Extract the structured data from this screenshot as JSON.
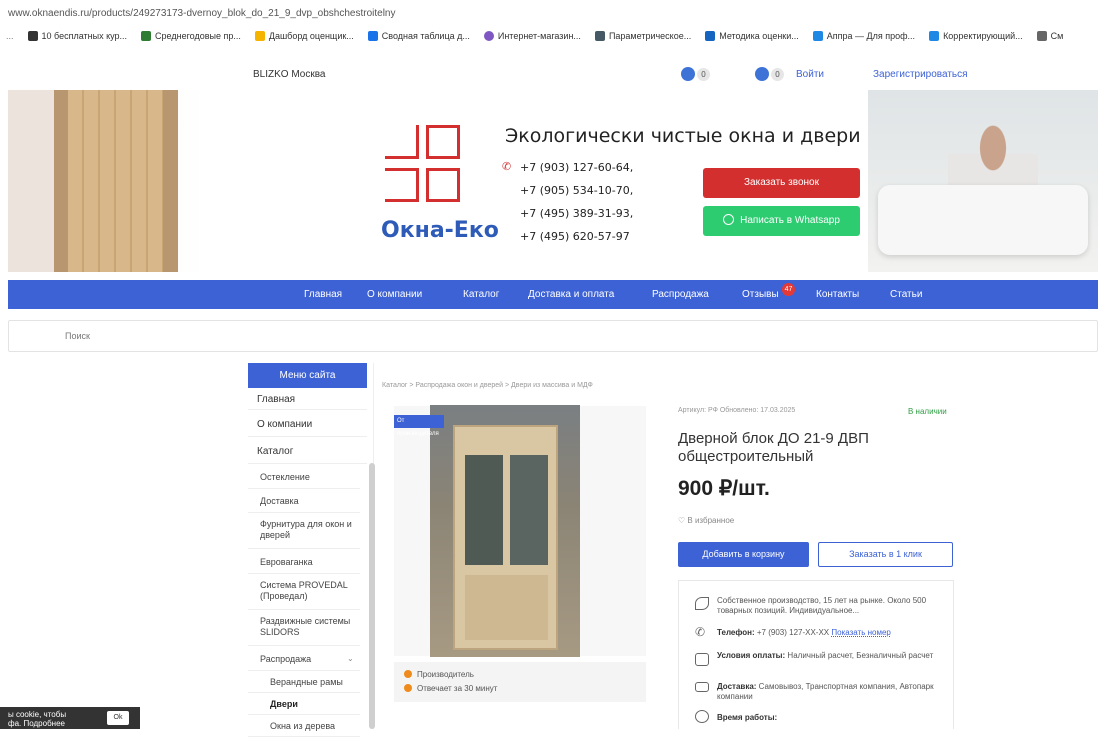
{
  "browser": {
    "url": "www.oknaendis.ru/products/249273173-dvernoy_blok_do_21_9_dvp_obshchestroitelny",
    "bookmarks": [
      {
        "label": "10 бесплатных кур...",
        "color": "#333"
      },
      {
        "label": "Среднегодовые пр...",
        "color": "#2e7d32"
      },
      {
        "label": "Дашборд оценщик...",
        "color": "#f4b400"
      },
      {
        "label": "Сводная таблица д...",
        "color": "#1a73e8"
      },
      {
        "label": "Интернет-магазин...",
        "color": "#7e57c2"
      },
      {
        "label": "Параметрическое...",
        "color": "#455a64"
      },
      {
        "label": "Методика оценки...",
        "color": "#1565c0"
      },
      {
        "label": "Аппра — Для проф...",
        "color": "#1e88e5"
      },
      {
        "label": "Корректирующий...",
        "color": "#1e88e5"
      },
      {
        "label": "См",
        "color": "#666"
      }
    ]
  },
  "topbar": {
    "city": "BLIZKO Москва",
    "fav_count": "0",
    "cart_count": "0",
    "login": "Войти",
    "register": "Зарегистрироваться"
  },
  "hero": {
    "brand": "Окна-Еко",
    "slogan": "Экологически чистые окна и двери",
    "phones": [
      "+7 (903) 127-60-64,",
      "+7 (905) 534-10-70,",
      "+7 (495) 389-31-93,",
      "+7 (495) 620-57-97"
    ],
    "call_btn": "Заказать звонок",
    "whatsapp_btn": "Написать в Whatsapp"
  },
  "nav": {
    "items": [
      "Главная",
      "О компании",
      "Каталог",
      "Доставка и оплата",
      "Распродажа",
      "Отзывы",
      "Контакты",
      "Статьи"
    ],
    "reviews_badge": "47"
  },
  "search": {
    "placeholder": "Поиск"
  },
  "sidebar": {
    "header": "Меню сайта",
    "items": [
      "Главная",
      "О компании",
      "Каталог"
    ],
    "sub_items": [
      "Остекление",
      "Доставка",
      "Фурнитура для окон и дверей",
      "Евроваганка",
      "Система PROVEDAL (Проведал)",
      "Раздвижные системы SLIDORS",
      "Распродажа"
    ],
    "sale_sub": [
      "Верандные рамы",
      "Двери",
      "Окна из дерева"
    ]
  },
  "breadcrumbs": "Каталог  >  Распродажа окон и дверей  >  Двери из массива и МДФ",
  "product": {
    "badge": "От производителя",
    "info_lines": [
      "Производитель",
      "Отвечает за 30 минут"
    ],
    "meta": "Артикул: РФ    Обновлено: 17.03.2025",
    "stock": "В наличии",
    "title": "Дверной блок ДО 21-9 ДВП общестроительный",
    "price": "900 ₽/шт.",
    "favorite": "В избранное",
    "cart_btn": "Добавить в корзину",
    "oneclick_btn": "Заказать в 1 клик"
  },
  "features": {
    "about": "Собственное производство, 15 лет на рынке. Около 500 товарных позиций. Индивидуальное...",
    "phone_label": "Телефон:",
    "phone_value": "+7 (903) 127-XX-XX",
    "show_number": "Показать номер",
    "payment_label": "Условия оплаты:",
    "payment_value": "Наличный расчет, Безналичный расчет",
    "delivery_label": "Доставка:",
    "delivery_value": "Самовывоз, Транспортная компания, Автопарк компании",
    "hours_label": "Время работы:"
  },
  "cookie": {
    "text": "ы cookie, чтобы",
    "text2": "фа. Подробнее",
    "ok": "Ok"
  },
  "colors": {
    "accent": "#3d62d6",
    "brand_red": "#d32f2f",
    "whatsapp": "#2ecc71",
    "in_stock": "#2e9e44"
  }
}
